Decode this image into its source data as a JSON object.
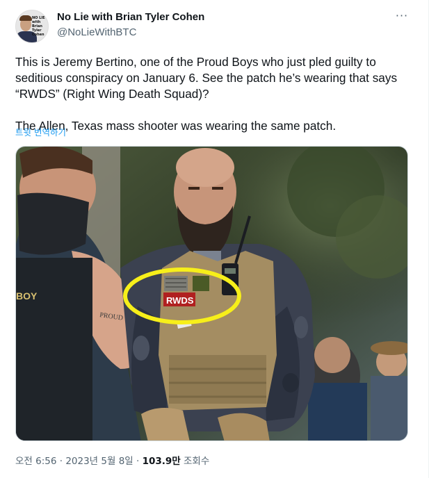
{
  "tweet": {
    "author_name": "No Lie with Brian Tyler Cohen",
    "author_handle": "@NoLieWithBTC",
    "avatar_logo_text": "NO LIE with Brian Tyler Cohen",
    "more_glyph": "···",
    "text_paragraph_1": "This is Jeremy Bertino, one of the Proud Boys who just pled guilty to seditious conspiracy on January 6. See the patch he’s wearing that says “RWDS” (Right Wing Death Squad)?",
    "text_paragraph_2": "The Allen, Texas mass shooter was wearing the same patch.",
    "translate_link": "트윗 번역하기",
    "photo": {
      "patch_text": "RWDS",
      "tattoo_text": "PROUD",
      "vest_text": "BOY",
      "highlight_color": "#f7ef1a"
    },
    "timestamp": "오전 6:56 · 2023년 5월 8일",
    "separator": " · ",
    "views_count": "103.9만",
    "views_label": " 조회수"
  }
}
